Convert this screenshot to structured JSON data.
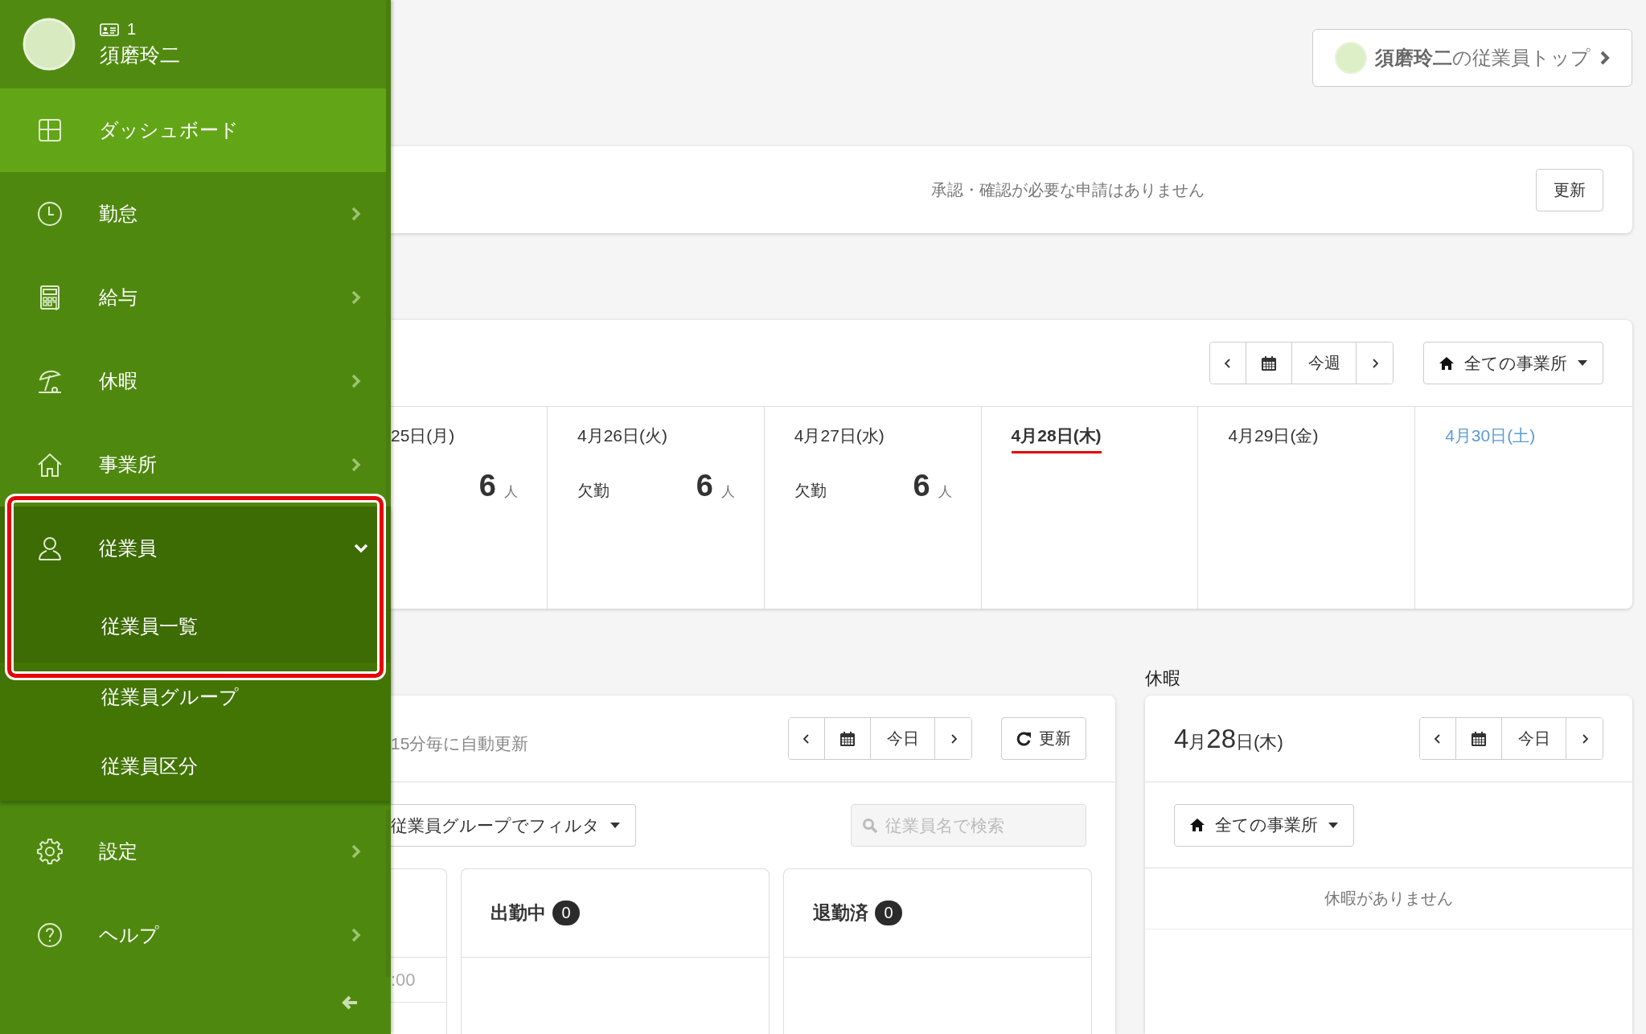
{
  "user": {
    "employee_id": "1",
    "name": "須磨玲二"
  },
  "sidebar": {
    "items": [
      {
        "label": "ダッシュボード",
        "selected": true,
        "has_submenu": false,
        "expanded": false,
        "highlighted": false
      },
      {
        "label": "勤怠",
        "selected": false,
        "has_submenu": true,
        "expanded": false,
        "highlighted": false
      },
      {
        "label": "給与",
        "selected": false,
        "has_submenu": true,
        "expanded": false,
        "highlighted": false
      },
      {
        "label": "休暇",
        "selected": false,
        "has_submenu": true,
        "expanded": false,
        "highlighted": false
      },
      {
        "label": "事業所",
        "selected": false,
        "has_submenu": true,
        "expanded": false,
        "highlighted": false
      },
      {
        "label": "従業員",
        "selected": false,
        "has_submenu": true,
        "expanded": true,
        "highlighted": true,
        "children": [
          {
            "label": "従業員一覧",
            "selected": false,
            "highlighted": true
          },
          {
            "label": "従業員グループ",
            "selected": false,
            "highlighted": false
          },
          {
            "label": "従業員区分",
            "selected": false,
            "highlighted": false
          }
        ]
      },
      {
        "label": "設定",
        "selected": false,
        "has_submenu": true,
        "expanded": false,
        "highlighted": false
      },
      {
        "label": "ヘルプ",
        "selected": false,
        "has_submenu": true,
        "expanded": false,
        "highlighted": false
      }
    ]
  },
  "employee_top_button": "**須磨玲二**の従業員トップ",
  "approvals": {
    "message": "承認・確認が必要な申請はありません",
    "refresh_button": "更新"
  },
  "week": {
    "period_button": "今週",
    "office_filter": "全ての事業所",
    "days": [
      {
        "date": "25日(月)",
        "kind": "weekday",
        "today": false,
        "count": "6",
        "unit": "人"
      },
      {
        "date": "4月26日(火)",
        "kind": "weekday",
        "today": false,
        "label": "欠勤",
        "count": "6",
        "unit": "人"
      },
      {
        "date": "4月27日(水)",
        "kind": "weekday",
        "today": false,
        "label": "欠勤",
        "count": "6",
        "unit": "人"
      },
      {
        "date": "4月28日(木)",
        "kind": "weekday",
        "today": true
      },
      {
        "date": "4月29日(金)",
        "kind": "weekday",
        "today": false
      },
      {
        "date": "4月30日(土)",
        "kind": "saturday",
        "today": false
      }
    ]
  },
  "attendance": {
    "auto_refresh": "15分毎に自動更新",
    "period_button": "今日",
    "refresh_button": "更新",
    "group_filter": "従業員グループでフィルタ",
    "search": {
      "placeholder": "従業員名で検索"
    },
    "columns": [
      {
        "entries": [
          ":00"
        ]
      },
      {
        "title": "出勤中",
        "count": "0"
      },
      {
        "title": "退勤済",
        "count": "0"
      }
    ]
  },
  "leave": {
    "heading": "休暇",
    "date": "4月28日(木)",
    "period_button": "今日",
    "office_filter": "全ての事業所",
    "empty_message": "休暇がありません"
  }
}
